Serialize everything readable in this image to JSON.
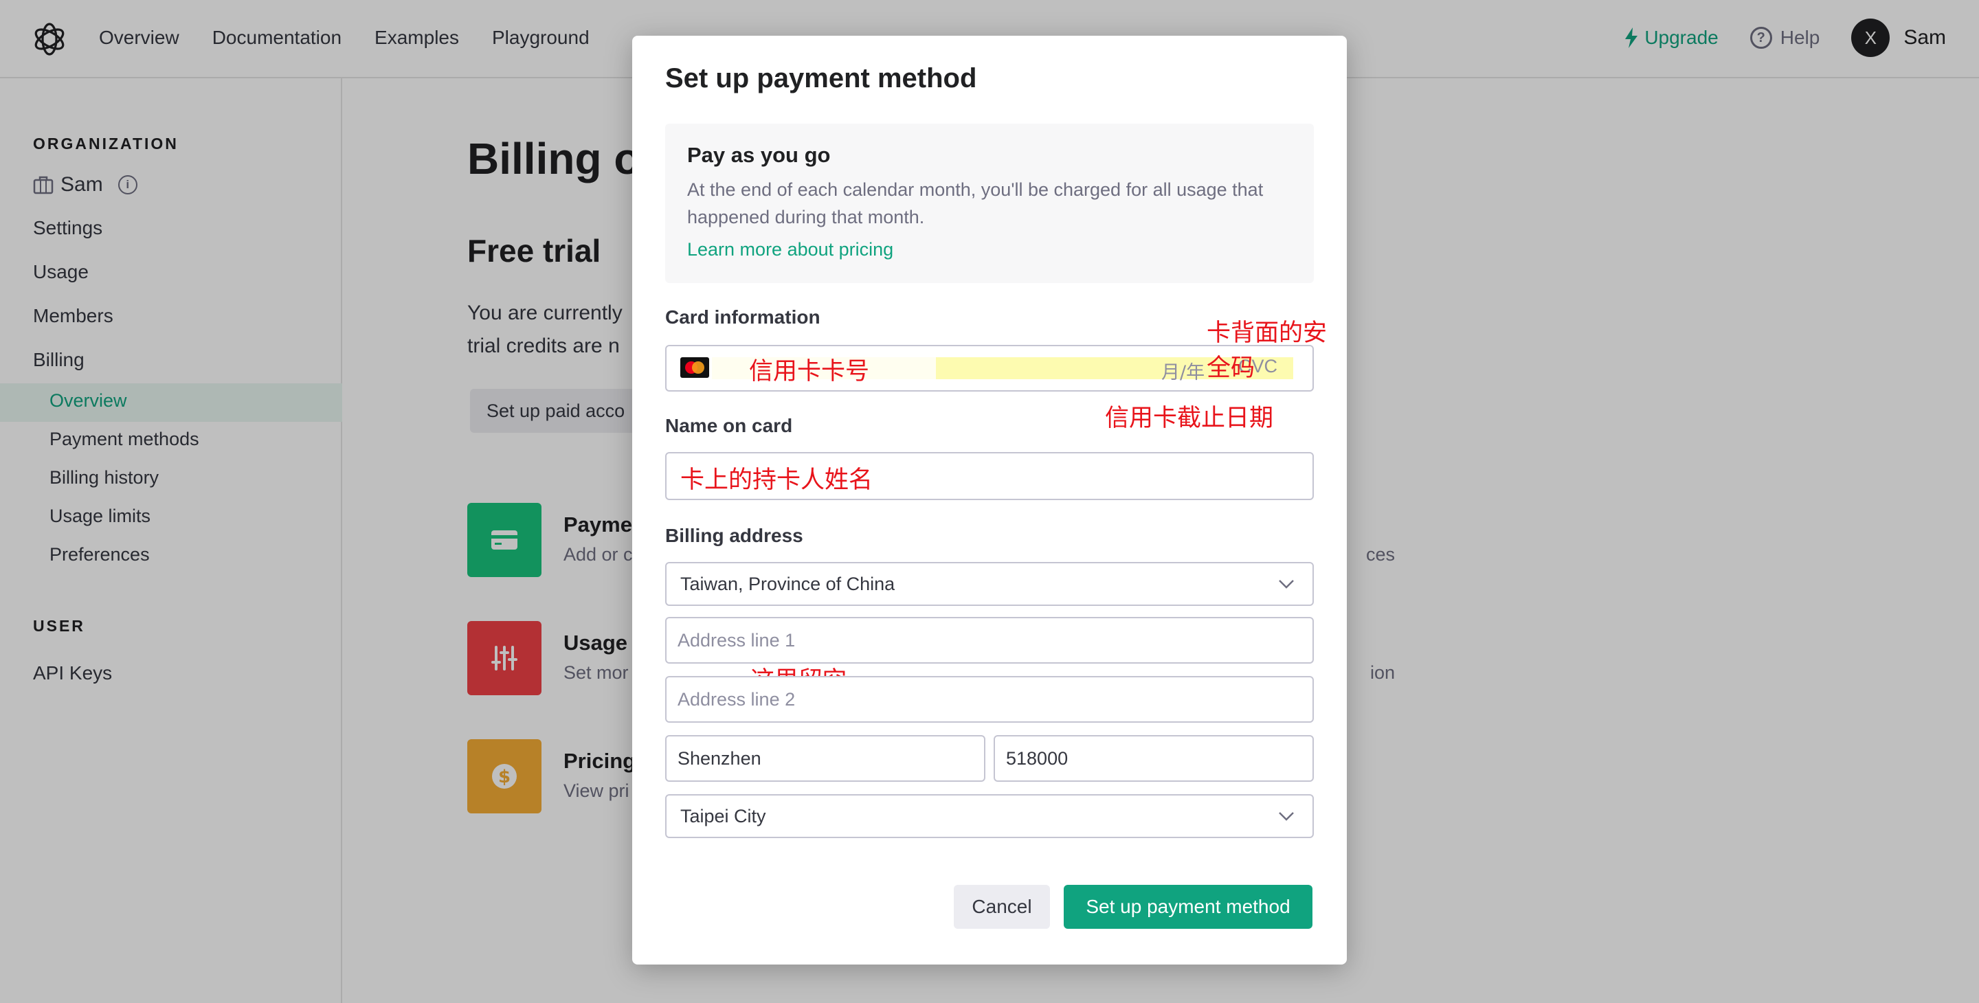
{
  "nav": {
    "links": [
      "Overview",
      "Documentation",
      "Examples",
      "Playground"
    ],
    "upgrade": "Upgrade",
    "help": "Help",
    "help_icon_glyph": "?",
    "user_initial": "X",
    "user_name": "Sam"
  },
  "sidebar": {
    "org_heading": "ORGANIZATION",
    "org_name": "Sam",
    "info_glyph": "i",
    "items": [
      "Settings",
      "Usage",
      "Members",
      "Billing"
    ],
    "billing_sub": [
      "Overview",
      "Payment methods",
      "Billing history",
      "Usage limits",
      "Preferences"
    ],
    "active_sub": "Overview",
    "user_heading": "USER",
    "user_items": [
      "API Keys"
    ]
  },
  "main": {
    "title": "Billing o",
    "free_title": "Free trial",
    "trial_line1": "You are currently",
    "trial_line2": "trial credits are n",
    "paid_button": "Set up paid acco",
    "cards": [
      {
        "title": "Payme",
        "desc": "Add or c",
        "tail": "ces",
        "icon": "credit-card-icon",
        "color": "#19c37d"
      },
      {
        "title": "Usage",
        "desc": "Set mor",
        "tail": "ion",
        "icon": "sliders-icon",
        "color": "#ef4146"
      },
      {
        "title": "Pricing",
        "desc": "View pri",
        "tail": "",
        "icon": "dollar-icon",
        "color": "#f4ac36"
      }
    ]
  },
  "modal": {
    "title": "Set up payment method",
    "plan": {
      "title": "Pay as you go",
      "description": "At the end of each calendar month, you'll be charged for all usage that happened during that month.",
      "link": "Learn more about pricing"
    },
    "card_info_label": "Card information",
    "card_expiry_placeholder": "月/年",
    "card_cvc_placeholder": "CVC",
    "name_label": "Name on card",
    "billing_label": "Billing address",
    "country": "Taiwan, Province of China",
    "address1_placeholder": "Address line 1",
    "address2_placeholder": "Address line 2",
    "city": "Shenzhen",
    "postal": "518000",
    "state": "Taipei City",
    "cancel": "Cancel",
    "submit": "Set up payment method"
  },
  "annotations": {
    "cvc_note": "卡背面的安全码",
    "card_number_note": "信用卡卡号",
    "expiry_note": "信用卡截止日期",
    "name_note": "卡上的持卡人姓名",
    "address2_note": "这里留空",
    "color": "#e8141b",
    "highlight": "#fdfbb0"
  }
}
